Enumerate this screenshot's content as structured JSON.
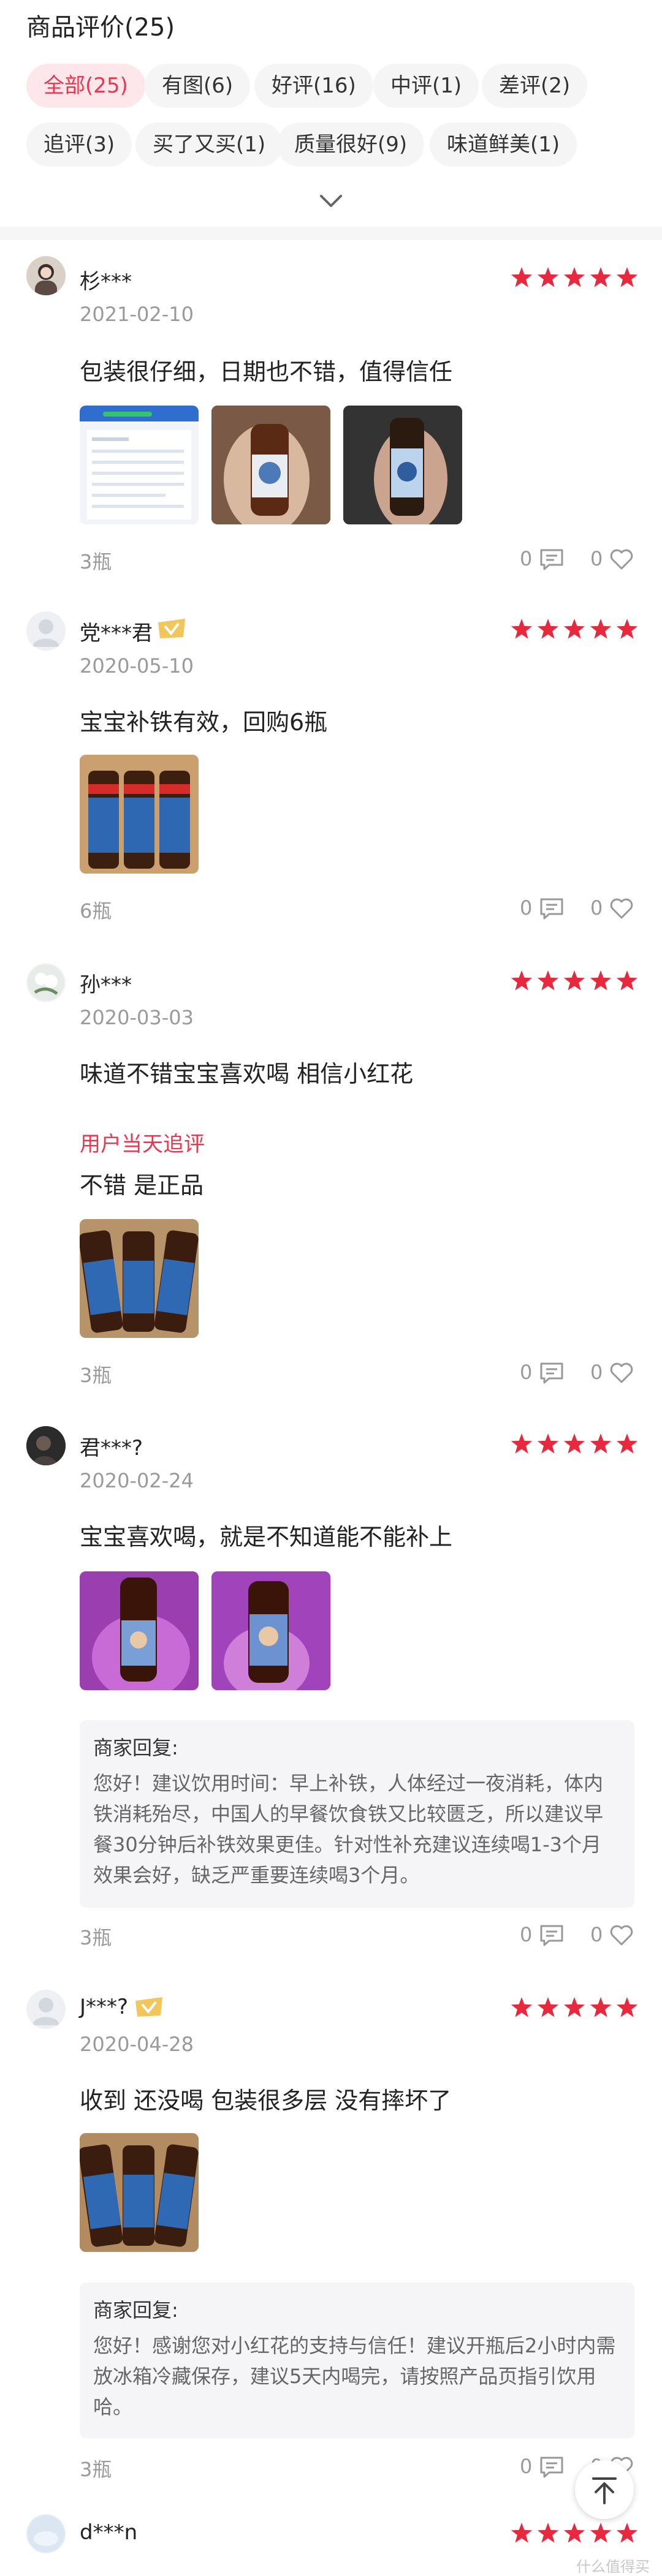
{
  "header": {
    "title": "商品评价(25)",
    "chips": [
      {
        "label": "全部(25)",
        "active": true
      },
      {
        "label": "有图(6)"
      },
      {
        "label": "好评(16)"
      },
      {
        "label": "中评(1)"
      },
      {
        "label": "差评(2)"
      },
      {
        "label": "追评(3)"
      },
      {
        "label": "买了又买(1)"
      },
      {
        "label": "质量很好(9)"
      },
      {
        "label": "味道鲜美(1)"
      }
    ]
  },
  "reviews": [
    {
      "user": "杉***",
      "date": "2021-02-10",
      "stars": 5,
      "content": "包装很仔细，日期也不错，值得信任",
      "spec": "3瓶",
      "comments": "0",
      "likes": "0"
    },
    {
      "user": "党***君",
      "date": "2020-05-10",
      "stars": 5,
      "content": "宝宝补铁有效，回购6瓶",
      "spec": "6瓶",
      "comments": "0",
      "likes": "0"
    },
    {
      "user": "孙***",
      "date": "2020-03-03",
      "stars": 5,
      "content": "味道不错宝宝喜欢喝 相信小红花",
      "followup_label": "用户当天追评",
      "followup_content": "不错 是正品",
      "spec": "3瓶",
      "comments": "0",
      "likes": "0"
    },
    {
      "user": "君***?",
      "date": "2020-02-24",
      "stars": 5,
      "content": "宝宝喜欢喝，就是不知道能不能补上",
      "reply_title": "商家回复:",
      "reply_text": "您好！建议饮用时间：早上补铁，人体经过一夜消耗，体内铁消耗殆尽，中国人的早餐饮食铁又比较匮乏，所以建议早餐30分钟后补铁效果更佳。针对性补充建议连续喝1-3个月效果会好，缺乏严重要连续喝3个月。",
      "spec": "3瓶",
      "comments": "0",
      "likes": "0"
    },
    {
      "user": "J***?",
      "date": "2020-04-28",
      "stars": 5,
      "content": "收到 还没喝 包装很多层 没有摔坏了",
      "reply_title": "商家回复:",
      "reply_text": "您好！感谢您对小红花的支持与信任！建议开瓶后2小时内需放冰箱冷藏保存，建议5天内喝完，请按照产品页指引饮用哈。",
      "spec": "3瓶",
      "comments": "0",
      "likes": "0"
    },
    {
      "user": "d***n",
      "stars": 5
    }
  ],
  "colors": {
    "accent": "#e8384f",
    "star": "#e8283c",
    "muted": "#9a9a9a"
  },
  "icons": {
    "comment": "comment-icon",
    "like": "heart-icon",
    "back_to_top": "arrow-up-icon",
    "expand": "chevron-down-icon"
  },
  "watermark": "什么值得买"
}
